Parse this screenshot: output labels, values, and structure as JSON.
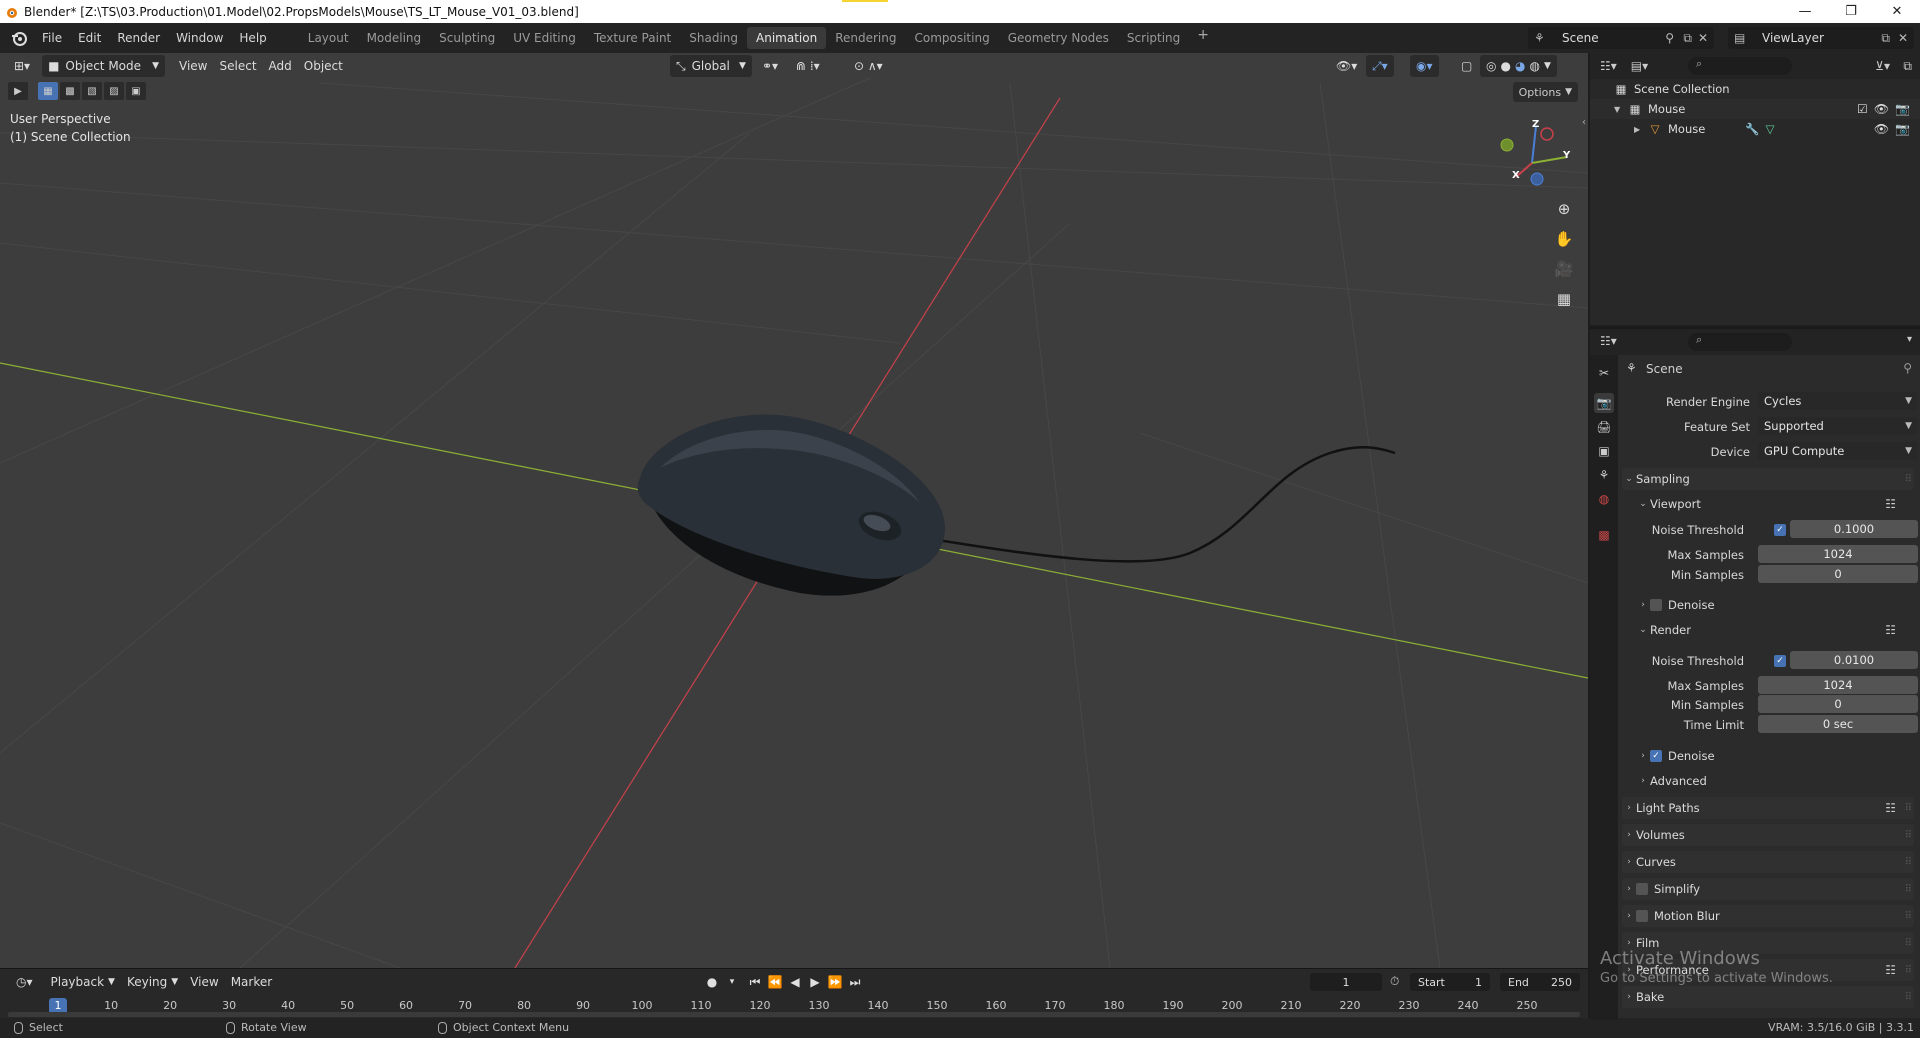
{
  "window": {
    "title": "Blender* [Z:\\TS\\03.Production\\01.Model\\02.PropsModels\\Mouse\\TS_LT_Mouse_V01_03.blend]",
    "buttons": [
      "—",
      "❐",
      "✕"
    ]
  },
  "topbar": {
    "menus": [
      "File",
      "Edit",
      "Render",
      "Window",
      "Help"
    ],
    "workspaces": [
      "Layout",
      "Modeling",
      "Sculpting",
      "UV Editing",
      "Texture Paint",
      "Shading",
      "Animation",
      "Rendering",
      "Compositing",
      "Geometry Nodes",
      "Scripting"
    ],
    "active_workspace": "Animation",
    "add_workspace": "+",
    "scene": "Scene",
    "view_layer": "ViewLayer"
  },
  "viewport": {
    "mode": "Object Mode",
    "menus": [
      "View",
      "Select",
      "Add",
      "Object"
    ],
    "orientation": "Global",
    "options": "Options",
    "perspective": "User Perspective",
    "collection": "(1) Scene Collection",
    "gizmo_labels": {
      "z": "Z",
      "y": "Y",
      "x": "X"
    },
    "colors": {
      "background": "#3d3d3d",
      "x_axis": "#c8414b",
      "y_axis": "#8db135"
    }
  },
  "timeline": {
    "menus": [
      "Playback",
      "Keying",
      "View",
      "Marker"
    ],
    "current_frame": "1",
    "start_label": "Start",
    "start": "1",
    "end_label": "End",
    "end": "250",
    "ruler": [
      "1",
      "10",
      "20",
      "30",
      "40",
      "50",
      "60",
      "70",
      "80",
      "90",
      "100",
      "110",
      "120",
      "130",
      "140",
      "150",
      "160",
      "170",
      "180",
      "190",
      "200",
      "210",
      "220",
      "230",
      "240",
      "250"
    ]
  },
  "statusbar": {
    "select": "Select",
    "rotate": "Rotate View",
    "context": "Object Context Menu",
    "vram": "VRAM: 3.5/16.0 GiB | 3.3.1"
  },
  "outliner": {
    "root": "Scene Collection",
    "collection": "Mouse",
    "object": "Mouse"
  },
  "properties": {
    "context": "Scene",
    "render_engine_label": "Render Engine",
    "render_engine": "Cycles",
    "feature_set_label": "Feature Set",
    "feature_set": "Supported",
    "device_label": "Device",
    "device": "GPU Compute",
    "sampling": "Sampling",
    "viewport": {
      "title": "Viewport",
      "noise_threshold_label": "Noise Threshold",
      "noise_threshold": "0.1000",
      "noise_threshold_enabled": true,
      "max_samples_label": "Max Samples",
      "max_samples": "1024",
      "min_samples_label": "Min Samples",
      "min_samples": "0",
      "denoise": "Denoise",
      "denoise_enabled": false
    },
    "render": {
      "title": "Render",
      "noise_threshold_label": "Noise Threshold",
      "noise_threshold": "0.0100",
      "noise_threshold_enabled": true,
      "max_samples_label": "Max Samples",
      "max_samples": "1024",
      "min_samples_label": "Min Samples",
      "min_samples": "0",
      "time_limit_label": "Time Limit",
      "time_limit": "0 sec",
      "denoise": "Denoise",
      "denoise_enabled": true
    },
    "advanced": "Advanced",
    "panels": [
      "Light Paths",
      "Volumes",
      "Curves",
      "Simplify",
      "Motion Blur",
      "Film",
      "Performance",
      "Bake"
    ]
  },
  "watermark": {
    "line1": "Activate Windows",
    "line2": "Go to Settings to activate Windows."
  }
}
